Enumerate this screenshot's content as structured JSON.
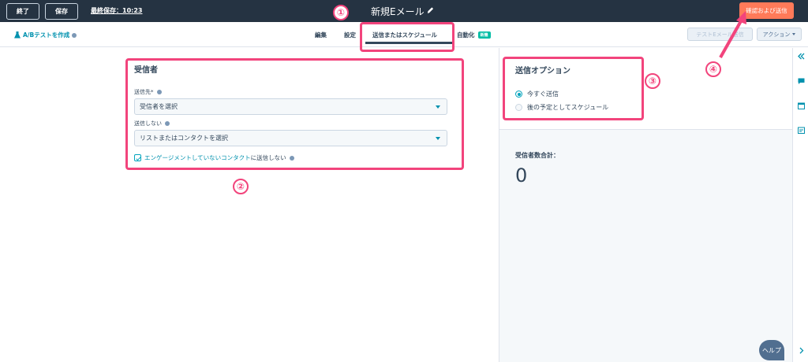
{
  "topbar": {
    "exit_label": "終了",
    "save_label": "保存",
    "last_saved": "最終保存：10:23",
    "email_title": "新規Eメール",
    "send_label": "確認および送信"
  },
  "subnav": {
    "ab_test": "A/Bテストを作成",
    "tabs": [
      {
        "label": "編集"
      },
      {
        "label": "設定"
      },
      {
        "label": "送信またはスケジュール",
        "active": true
      },
      {
        "label": "自動化",
        "badge": "新機"
      }
    ],
    "test_email_label": "テストEメール送信",
    "actions_label": "アクション"
  },
  "recipients": {
    "title": "受信者",
    "send_to_label": "送信先*",
    "send_to_placeholder": "受信者を選択",
    "dont_send_label": "送信しない",
    "dont_send_placeholder": "リストまたはコンタクトを選択",
    "checkbox_link": "エンゲージメントしていないコンタクト",
    "checkbox_suffix": "に送信しない",
    "checkbox_checked": true
  },
  "send_options": {
    "title": "送信オプション",
    "options": [
      {
        "label": "今すぐ送信",
        "selected": true
      },
      {
        "label": "後の予定としてスケジュール",
        "selected": false
      }
    ]
  },
  "totals": {
    "label": "受信者数合計：",
    "value": "0"
  },
  "help_label": "ヘルプ",
  "annotations": [
    "①",
    "②",
    "③",
    "④"
  ],
  "colors": {
    "accent": "#ff7a59",
    "highlight": "#f2447c",
    "topbar": "#253342",
    "link": "#0091ae"
  }
}
